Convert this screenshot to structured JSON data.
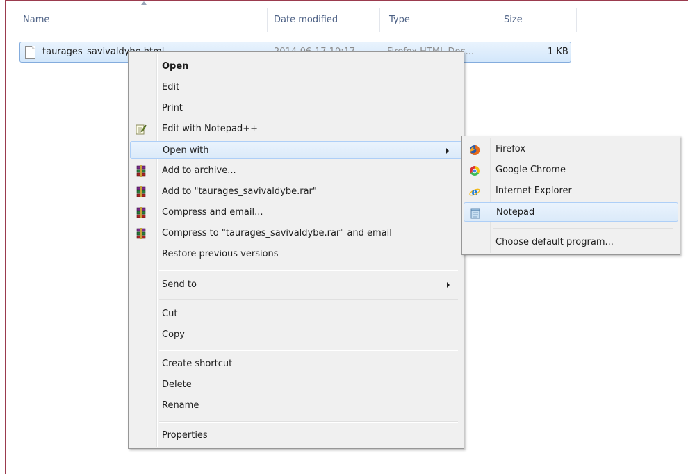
{
  "columns": {
    "name": "Name",
    "date_modified": "Date modified",
    "type": "Type",
    "size": "Size"
  },
  "file": {
    "name": "taurages_savivaldybe.html",
    "date_modified": "2014-06-17 10:17",
    "type": "Firefox HTML Doc...",
    "size": "1 KB"
  },
  "context_menu": {
    "open": "Open",
    "edit": "Edit",
    "print": "Print",
    "edit_notepadpp": "Edit with Notepad++",
    "open_with": "Open with",
    "add_archive": "Add to archive...",
    "add_rar": "Add to \"taurages_savivaldybe.rar\"",
    "compress_email": "Compress and email...",
    "compress_rar_email": "Compress to \"taurages_savivaldybe.rar\" and email",
    "restore": "Restore previous versions",
    "send_to": "Send to",
    "cut": "Cut",
    "copy": "Copy",
    "create_shortcut": "Create shortcut",
    "delete": "Delete",
    "rename": "Rename",
    "properties": "Properties"
  },
  "open_with_menu": {
    "firefox": "Firefox",
    "chrome": "Google Chrome",
    "ie": "Internet Explorer",
    "notepad": "Notepad",
    "choose_default": "Choose default program..."
  },
  "icons": {
    "notepadpp": "notepadpp-icon",
    "winrar": "winrar-icon",
    "firefox": "firefox-icon",
    "chrome": "chrome-icon",
    "ie": "internet-explorer-icon",
    "notepad": "notepad-icon"
  },
  "colors": {
    "window_frame": "#9b3b4e",
    "selection_bg": "#d3e7fb",
    "menu_bg": "#f0f0f0",
    "header_text": "#4d6185"
  }
}
